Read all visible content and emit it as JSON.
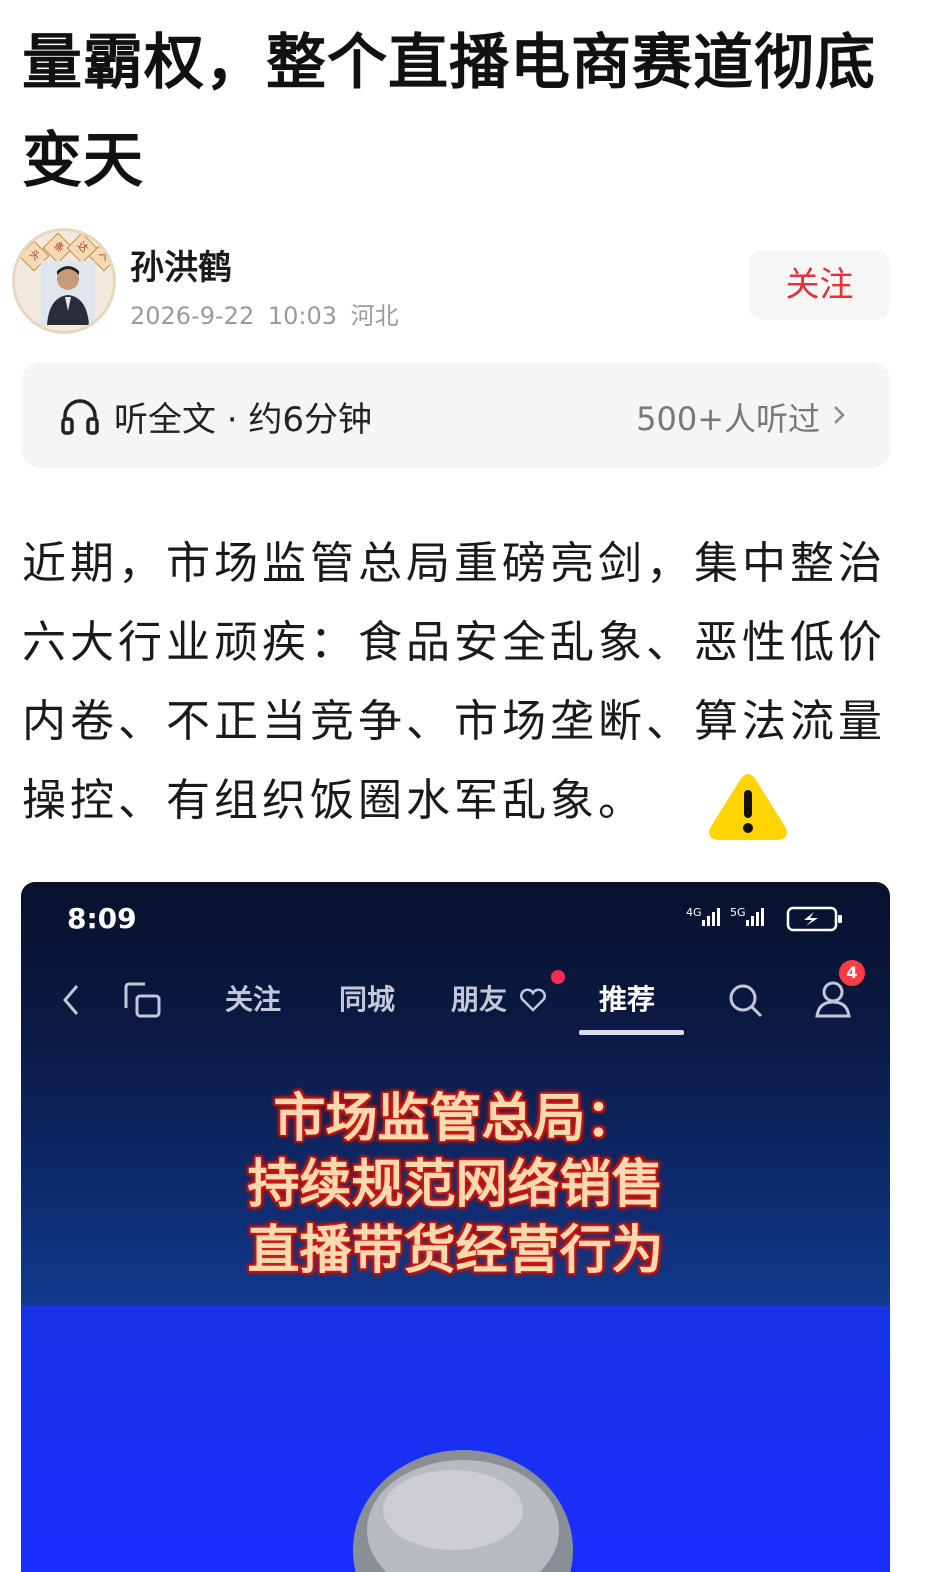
{
  "article": {
    "title_line1": "量霸权，整个直播电商赛道彻底",
    "title_line2": "变天"
  },
  "author": {
    "name": "孙洪鹤",
    "date": "2026-9-22",
    "time": "10:03",
    "location": "河北",
    "avatar_badge": [
      "头",
      "条",
      "达",
      "人"
    ],
    "follow_label": "关注"
  },
  "listen": {
    "label": "听全文 · 约6分钟",
    "count": "500+人听过"
  },
  "content": {
    "paragraph": "近期，市场监管总局重磅亮剑，集中整治六大行业顽疾：食品安全乱象、恶性低价内卷、不正当竞争、市场垄断、算法流量操控、有组织饭圈水军乱象。"
  },
  "embedded_screenshot": {
    "time": "8:09",
    "signal_labels": [
      "4G",
      "5G"
    ],
    "tabs": [
      "关注",
      "同城",
      "朋友",
      "推荐"
    ],
    "active_tab": "推荐",
    "notification_count": "4",
    "headline_lines": [
      "市场监管总局：",
      "持续规范网络销售",
      "直播带货经营行为"
    ]
  },
  "colors": {
    "follow_text": "#e1333a",
    "warning": "#ffd400",
    "embedded_blue": "#1a2dff"
  },
  "icons": [
    "headphones-icon",
    "chevron-right-icon",
    "warning-icon",
    "back-icon",
    "multi-window-icon",
    "heart-icon",
    "search-icon",
    "profile-icon",
    "battery-icon"
  ]
}
